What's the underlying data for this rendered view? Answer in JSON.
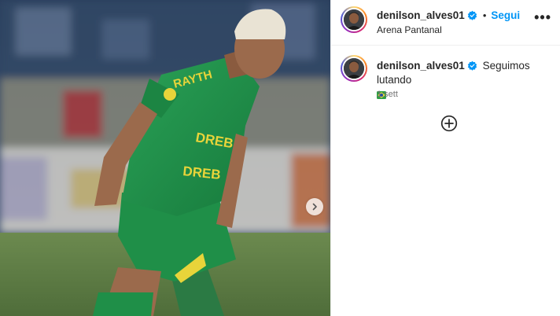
{
  "post": {
    "author": {
      "username": "denilson_alves01",
      "verified": true,
      "location": "Arena Pantanal",
      "follow_label": "Segui",
      "separator": "•"
    },
    "more_options_icon": "more-horizontal-icon",
    "caption": {
      "username": "denilson_alves01",
      "text": "Seguimos lutando",
      "emoji": "brazil-flag"
    },
    "timestamp": "1 sett",
    "load_more_icon": "plus-circle-icon",
    "carousel_next_icon": "chevron-right-icon",
    "colors": {
      "follow": "#0095f6",
      "verified": "#0095f6",
      "jersey": "#1f8f48",
      "jersey_print": "#e8d43a"
    }
  }
}
